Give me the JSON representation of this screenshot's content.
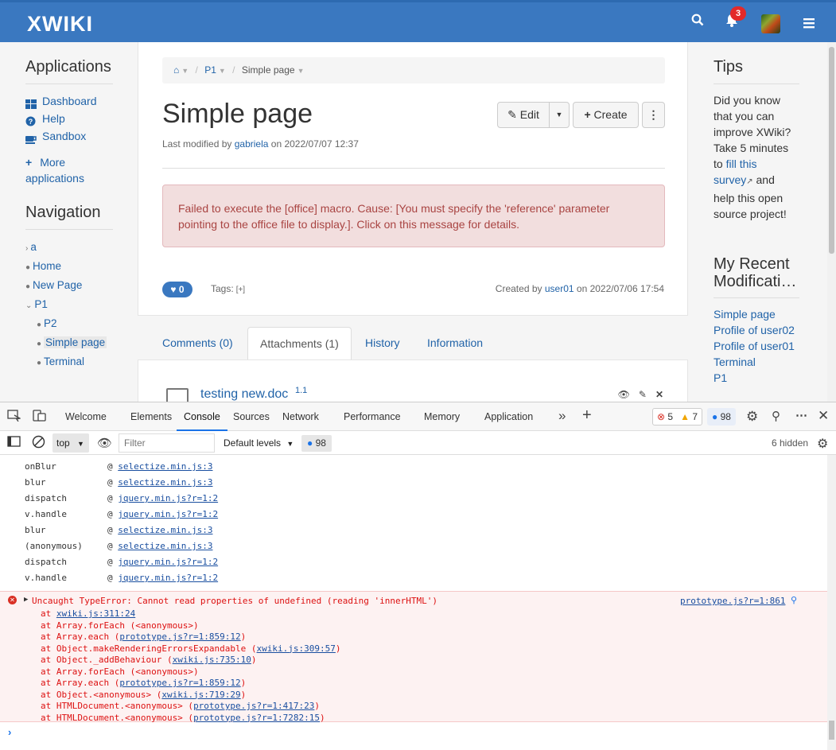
{
  "topbar": {
    "logo": "XWIKI",
    "notification_count": "3"
  },
  "left": {
    "applications_title": "Applications",
    "apps": [
      {
        "label": "Dashboard"
      },
      {
        "label": "Help"
      },
      {
        "label": "Sandbox"
      }
    ],
    "more_apps_line1": "More",
    "more_apps_line2": "applications",
    "navigation_title": "Navigation",
    "nav": [
      "a",
      "Home",
      "New Page",
      "P1",
      "P2",
      "Simple page",
      "Terminal"
    ]
  },
  "content": {
    "breadcrumb": [
      "P1",
      "Simple page"
    ],
    "title": "Simple page",
    "modified_prefix": "Last modified by",
    "modified_user": "gabriela",
    "modified_suffix": "on 2022/07/07 12:37",
    "edit_label": "Edit",
    "create_label": "Create",
    "error_message": "Failed to execute the [office] macro. Cause: [You must specify the 'reference' parameter pointing to the office file to display.]. Click on this message for details.",
    "likes": "0",
    "tags_label": "Tags:",
    "tags_add": "[+]",
    "created_prefix": "Created by",
    "created_user": "user01",
    "created_suffix": "on 2022/07/06 17:54"
  },
  "tabs": [
    {
      "label": "Comments (0)"
    },
    {
      "label": "Attachments (1)"
    },
    {
      "label": "History"
    },
    {
      "label": "Information"
    }
  ],
  "attachment": {
    "name": "testing new.doc",
    "version": "1.1"
  },
  "right": {
    "tips_title": "Tips",
    "tips_lines": [
      "Did you know",
      "that you can",
      "improve XWiki?",
      "Take 5 minutes"
    ],
    "tips_to": "to",
    "tips_link1": "fill this",
    "tips_link2": "survey",
    "tips_and": "and",
    "tips_end_lines": [
      "help this open",
      "source project!"
    ],
    "recent_title_line1": "My Recent",
    "recent_title_line2": "Modificati…",
    "recent": [
      "Simple page",
      "Profile of user02",
      "Profile of user01",
      "Terminal",
      "P1"
    ]
  },
  "devtools": {
    "tabs": [
      "Welcome",
      "Elements",
      "Console",
      "Sources",
      "Network",
      "Performance",
      "Memory",
      "Application"
    ],
    "errors": "5",
    "warnings": "7",
    "messages": "98",
    "context": "top",
    "filter_placeholder": "Filter",
    "levels": "Default levels",
    "hidden": "6 hidden",
    "stack": [
      {
        "fn": "onBlur",
        "src": "selectize.min.js:3"
      },
      {
        "fn": "blur",
        "src": "selectize.min.js:3"
      },
      {
        "fn": "dispatch",
        "src": "jquery.min.js?r=1:2"
      },
      {
        "fn": "v.handle",
        "src": "jquery.min.js?r=1:2"
      },
      {
        "fn": "blur",
        "src": "selectize.min.js:3"
      },
      {
        "fn": "(anonymous)",
        "src": "selectize.min.js:3"
      },
      {
        "fn": "dispatch",
        "src": "jquery.min.js?r=1:2"
      },
      {
        "fn": "v.handle",
        "src": "jquery.min.js?r=1:2"
      }
    ],
    "error_head": "Uncaught TypeError: Cannot read properties of undefined (reading 'innerHTML')",
    "error_source": "prototype.js?r=1:861",
    "error_lines": [
      {
        "pre": "at ",
        "link": "xwiki.js:311:24",
        "post": ""
      },
      {
        "pre": "at Array.forEach (<anonymous>)",
        "link": "",
        "post": ""
      },
      {
        "pre": "at Array.each (",
        "link": "prototype.js?r=1:859:12",
        "post": ")"
      },
      {
        "pre": "at Object.makeRenderingErrorsExpandable (",
        "link": "xwiki.js:309:57",
        "post": ")"
      },
      {
        "pre": "at Object._addBehaviour (",
        "link": "xwiki.js:735:10",
        "post": ")"
      },
      {
        "pre": "at Array.forEach (<anonymous>)",
        "link": "",
        "post": ""
      },
      {
        "pre": "at Array.each (",
        "link": "prototype.js?r=1:859:12",
        "post": ")"
      },
      {
        "pre": "at Object.<anonymous> (",
        "link": "xwiki.js:719:29",
        "post": ")"
      },
      {
        "pre": "at HTMLDocument.<anonymous> (",
        "link": "prototype.js?r=1:417:23",
        "post": ")"
      },
      {
        "pre": "at HTMLDocument.<anonymous> (",
        "link": "prototype.js?r=1:7282:15",
        "post": ")"
      }
    ]
  }
}
